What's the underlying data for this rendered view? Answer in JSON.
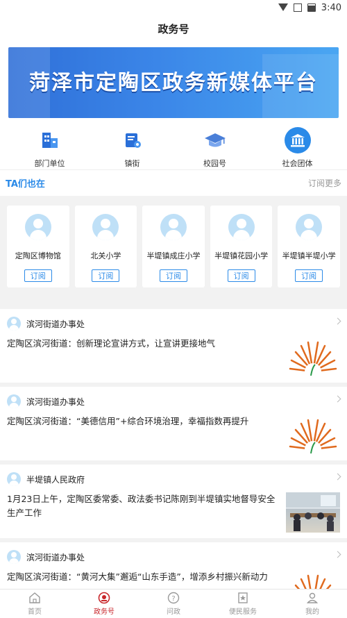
{
  "status_bar": {
    "time": "3:40"
  },
  "header": {
    "title": "政务号"
  },
  "banner": {
    "text": "菏泽市定陶区政务新媒体平台"
  },
  "quick_nav": [
    {
      "label": "部门单位",
      "icon": "building-icon"
    },
    {
      "label": "镇街",
      "icon": "town-icon"
    },
    {
      "label": "校园号",
      "icon": "graduation-cap-icon"
    },
    {
      "label": "社会团体",
      "icon": "institution-icon"
    }
  ],
  "ta_section": {
    "title": "TA们也在",
    "more": "订阅更多"
  },
  "subscriptions": [
    {
      "name": "定陶区博物馆",
      "button": "订阅"
    },
    {
      "name": "北关小学",
      "button": "订阅"
    },
    {
      "name": "半堤镇成庄小学",
      "button": "订阅"
    },
    {
      "name": "半堤镇花园小学",
      "button": "订阅"
    },
    {
      "name": "半堤镇半堤小学",
      "button": "订阅"
    }
  ],
  "feed": [
    {
      "source": "滨河街道办事处",
      "title": "定陶区滨河街道：创新理论宣讲方式，让宣讲更接地气",
      "thumb": "logo"
    },
    {
      "source": "滨河街道办事处",
      "title": "定陶区滨河街道：“美德信用”+综合环境治理，幸福指数再提升",
      "thumb": "logo"
    },
    {
      "source": "半堤镇人民政府",
      "title": "1月23日上午，定陶区委常委、政法委书记陈刚到半堤镇实地督导安全生产工作",
      "thumb": "photo"
    },
    {
      "source": "滨河街道办事处",
      "title": "定陶区滨河街道：“黄河大集”邂逅“山东手造”，增添乡村振兴新动力",
      "thumb": "logo"
    }
  ],
  "tabbar": [
    {
      "label": "首页",
      "icon": "home-icon",
      "active": false
    },
    {
      "label": "政务号",
      "icon": "emblem-icon",
      "active": true
    },
    {
      "label": "问政",
      "icon": "question-icon",
      "active": false
    },
    {
      "label": "便民服务",
      "icon": "service-icon",
      "active": false
    },
    {
      "label": "我的",
      "icon": "user-icon",
      "active": false
    }
  ],
  "colors": {
    "accent": "#2a8ae8",
    "active_tab": "#c8262b",
    "banner": "#3b86e8"
  }
}
